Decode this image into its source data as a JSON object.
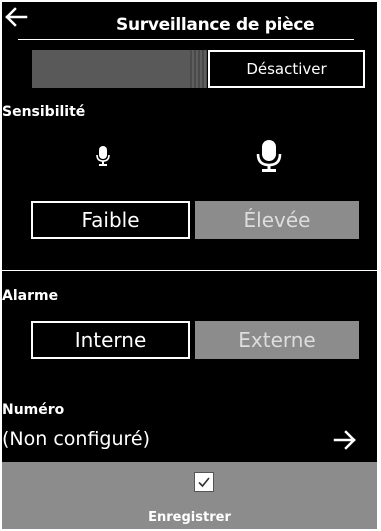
{
  "header": {
    "title": "Surveillance de pièce",
    "back_icon": "arrow-left-icon"
  },
  "toggle": {
    "state": "off",
    "off_label": "Désactiver"
  },
  "sensitivity": {
    "label": "Sensibilité",
    "low_icon": "microphone-small-icon",
    "high_icon": "microphone-large-icon",
    "options": [
      {
        "label": "Faible",
        "selected": true
      },
      {
        "label": "Élevée",
        "selected": false
      }
    ]
  },
  "alarm": {
    "label": "Alarme",
    "options": [
      {
        "label": "Interne",
        "selected": true
      },
      {
        "label": "Externe",
        "selected": false
      }
    ]
  },
  "number": {
    "label": "Numéro",
    "value": "(Non configuré)",
    "next_icon": "arrow-right-icon"
  },
  "footer": {
    "save_icon": "checkmark-icon",
    "save_label": "Enregistrer"
  },
  "colors": {
    "background": "#000000",
    "text": "#ffffff",
    "unselected_fill": "#8c8c8c",
    "toggle_fill": "#595959"
  }
}
